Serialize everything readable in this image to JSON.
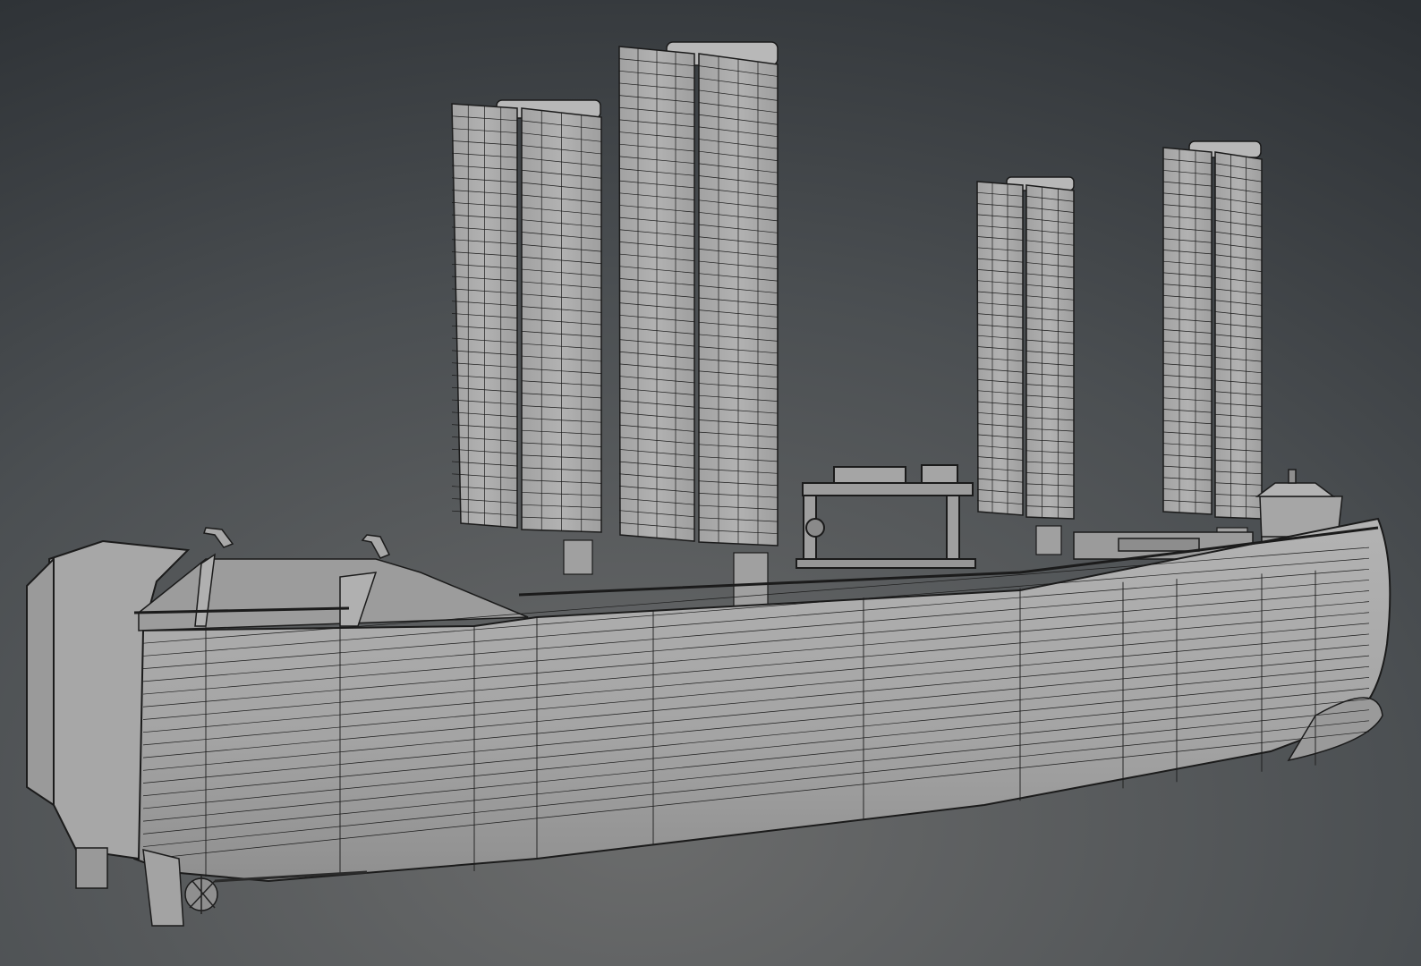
{
  "viewport": {
    "view_mode": "wireframe-on-shaded",
    "background_top": "#2c3034",
    "background_bottom": "#6b6c6c",
    "mesh_shade": "#a9a9a9",
    "mesh_shade_dark": "#8e8e8e",
    "wire_color": "#1b1b1b"
  },
  "model": {
    "object": "cargo-ship",
    "rigid_sails": [
      {
        "id": "sail-1"
      },
      {
        "id": "sail-2"
      },
      {
        "id": "sail-3"
      },
      {
        "id": "sail-4"
      }
    ],
    "deck_equipment": [
      "gantry-crane",
      "bridge-superstructure",
      "railings",
      "vents"
    ]
  }
}
